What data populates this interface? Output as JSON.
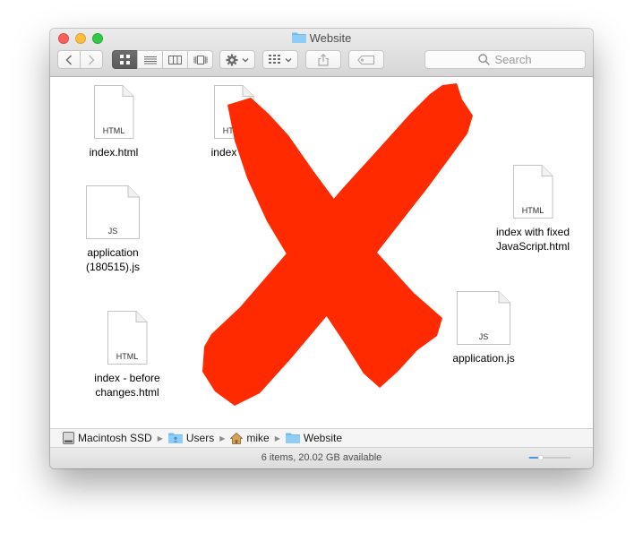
{
  "window": {
    "title": "Website",
    "search_placeholder": "Search"
  },
  "files": [
    {
      "name": "index.html",
      "type": "HTML"
    },
    {
      "name": "index (Ap",
      "type": "HTML"
    },
    {
      "name": "application\n(180515).js",
      "type": "JS"
    },
    {
      "name": "index with fixed\nJavaScript.html",
      "type": "HTML"
    },
    {
      "name": "application.js",
      "type": "JS"
    },
    {
      "name": "index - before\nchanges.html",
      "type": "HTML"
    }
  ],
  "pathbar": [
    "Macintosh SSD",
    "Users",
    "mike",
    "Website"
  ],
  "status": "6 items, 20.02 GB available",
  "icon_zoom_level": 0.25,
  "colors": {
    "cross": "#ff2a00",
    "folder": "#6fbcf1"
  }
}
